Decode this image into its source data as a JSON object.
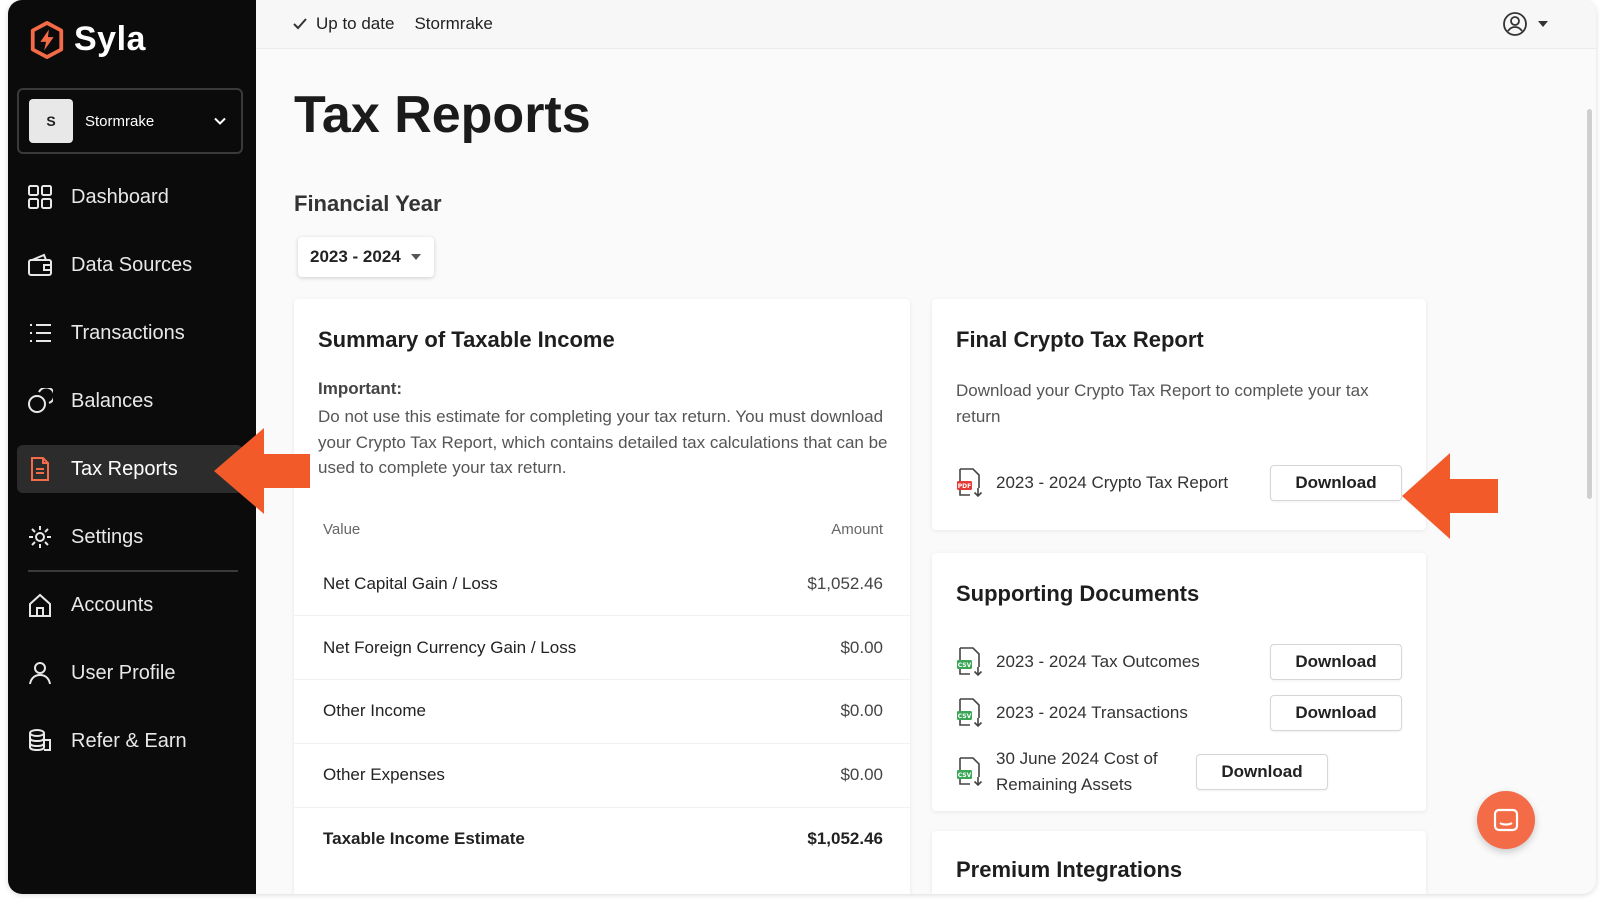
{
  "app": {
    "name": "Syla"
  },
  "account": {
    "initial": "S",
    "name": "Stormrake"
  },
  "sidebar": {
    "items": [
      {
        "label": "Dashboard",
        "icon": "dashboard-icon"
      },
      {
        "label": "Data Sources",
        "icon": "wallet-icon"
      },
      {
        "label": "Transactions",
        "icon": "list-icon"
      },
      {
        "label": "Balances",
        "icon": "coins-icon"
      },
      {
        "label": "Tax Reports",
        "icon": "document-icon",
        "active": true
      },
      {
        "label": "Settings",
        "icon": "gear-icon"
      },
      {
        "label": "Accounts",
        "icon": "home-icon"
      },
      {
        "label": "User Profile",
        "icon": "user-icon"
      },
      {
        "label": "Refer & Earn",
        "icon": "stack-icon"
      }
    ]
  },
  "topbar": {
    "status": "Up to date",
    "account": "Stormrake"
  },
  "page": {
    "title": "Tax Reports"
  },
  "financial_year": {
    "label": "Financial Year",
    "selected": "2023 - 2024"
  },
  "summary": {
    "title": "Summary of Taxable Income",
    "important_label": "Important:",
    "important_text": "Do not use this estimate for completing your tax return. You must download your Crypto Tax Report, which contains detailed tax calculations that can be used to complete your tax return.",
    "columns": {
      "value": "Value",
      "amount": "Amount"
    },
    "rows": [
      {
        "label": "Net Capital Gain / Loss",
        "amount": "$1,052.46"
      },
      {
        "label": "Net Foreign Currency Gain / Loss",
        "amount": "$0.00"
      },
      {
        "label": "Other Income",
        "amount": "$0.00"
      },
      {
        "label": "Other Expenses",
        "amount": "$0.00"
      },
      {
        "label": "Taxable Income Estimate",
        "amount": "$1,052.46"
      }
    ]
  },
  "final_report": {
    "title": "Final Crypto Tax Report",
    "description": "Download your Crypto Tax Report to complete your tax return",
    "file": {
      "label": "2023 - 2024 Crypto Tax Report",
      "type": "PDF"
    },
    "button": "Download"
  },
  "supporting": {
    "title": "Supporting Documents",
    "files": [
      {
        "label": "2023 - 2024 Tax Outcomes",
        "type": "CSV",
        "button": "Download"
      },
      {
        "label": "2023 - 2024 Transactions",
        "type": "CSV",
        "button": "Download"
      },
      {
        "label": "30 June 2024 Cost of Remaining Assets",
        "type": "CSV",
        "button": "Download"
      }
    ]
  },
  "premium": {
    "title": "Premium Integrations"
  },
  "colors": {
    "brand": "#f36b47",
    "sidebar_bg": "#0b0b0b",
    "pdf": "#e53935",
    "csv": "#3aa757"
  },
  "icons": {
    "chat": "chat-icon",
    "user_menu": "user-circle-icon"
  }
}
